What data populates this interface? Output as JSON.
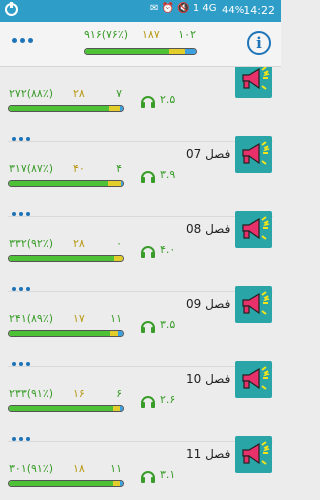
{
  "status_bar": {
    "icons_text": "✉ ⏰ 🔇 1 4G",
    "battery": "44%",
    "time": "14:22"
  },
  "header": {
    "total_right": "۱۰۲",
    "total_mid": "۱۸۷",
    "total_left": "۹۱۶(۷۶٪)",
    "progress": {
      "green": 0.76,
      "yellow": 0.14,
      "blue": 0.1
    }
  },
  "lessons": [
    {
      "title": "",
      "stats_a": "۲۷۲(۸۸٪)",
      "stats_b": "۲۸",
      "stats_c": "۷",
      "duration": "۲.۵",
      "progress": {
        "green": 0.88,
        "yellow": 0.09,
        "blue": 0.03
      }
    },
    {
      "title": "فصل 07",
      "stats_a": "۳۱۷(۸۷٪)",
      "stats_b": "۴۰",
      "stats_c": "۴",
      "duration": "۳.۹",
      "progress": {
        "green": 0.87,
        "yellow": 0.11,
        "blue": 0.02
      }
    },
    {
      "title": "فصل 08",
      "stats_a": "۳۳۲(۹۲٪)",
      "stats_b": "۲۸",
      "stats_c": "۰",
      "duration": "۴.۰",
      "progress": {
        "green": 0.92,
        "yellow": 0.08,
        "blue": 0.0
      }
    },
    {
      "title": "فصل 09",
      "stats_a": "۲۴۱(۸۹٪)",
      "stats_b": "۱۷",
      "stats_c": "۱۱",
      "duration": "۳.۵",
      "progress": {
        "green": 0.89,
        "yellow": 0.07,
        "blue": 0.04
      }
    },
    {
      "title": "فصل 10",
      "stats_a": "۲۳۳(۹۱٪)",
      "stats_b": "۱۶",
      "stats_c": "۶",
      "duration": "۲.۶",
      "progress": {
        "green": 0.91,
        "yellow": 0.06,
        "blue": 0.03
      }
    },
    {
      "title": "فصل 11",
      "stats_a": "۳۰۱(۹۱٪)",
      "stats_b": "۱۸",
      "stats_c": "۱۱",
      "duration": "۳.۱",
      "progress": {
        "green": 0.91,
        "yellow": 0.06,
        "blue": 0.03
      }
    }
  ],
  "icons": {
    "menu": "more-dots-icon",
    "info": "info-icon",
    "listen": "headphones-icon",
    "thumbnail": "megaphone-icon"
  },
  "colors": {
    "status_bar": "#2e9ec9",
    "accent_blue": "#1e74b8",
    "correct_green": "#4ec236",
    "partial_yellow": "#e3cd2a",
    "remaining_blue": "#3aa0e0",
    "thumb_teal": "#2aa5a7"
  }
}
